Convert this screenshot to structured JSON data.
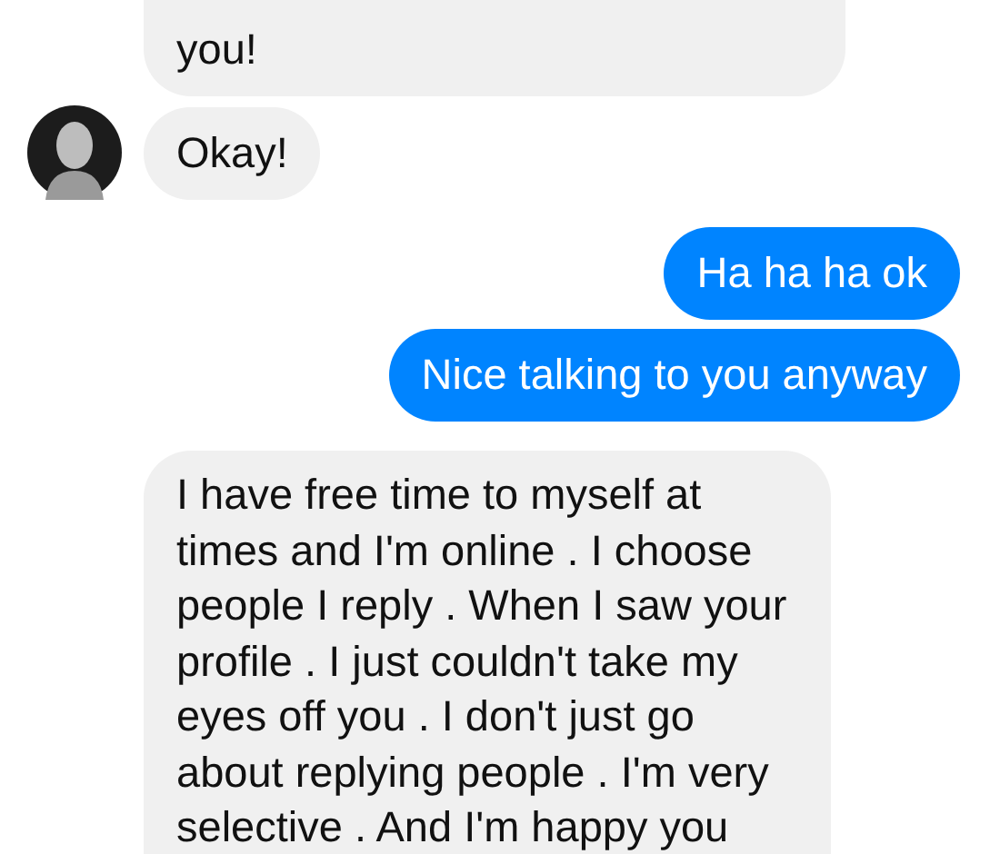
{
  "messages": [
    {
      "kind": "incoming",
      "avatar": false,
      "text": "you!"
    },
    {
      "kind": "incoming",
      "avatar": true,
      "text": "Okay!"
    },
    {
      "kind": "outgoing",
      "text": "Ha ha ha ok"
    },
    {
      "kind": "outgoing",
      "text": "Nice talking to you anyway"
    },
    {
      "kind": "incoming",
      "avatar": false,
      "text": "I have free time to myself at times and I'm online . I choose people I reply . When I saw your profile . I just couldn't take my eyes off you . I don't just go about replying people . I'm very selective . And I'm happy you"
    }
  ]
}
